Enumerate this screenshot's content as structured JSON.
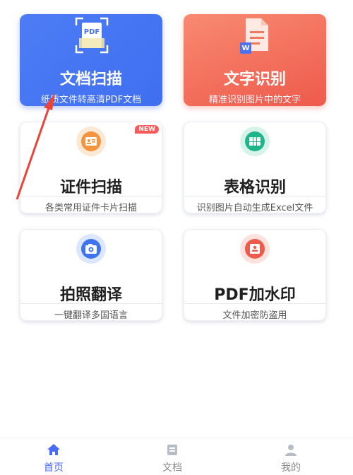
{
  "cards": {
    "doc_scan": {
      "title": "文档扫描",
      "subtitle": "纸质文件转高清PDF文档",
      "icon_label": "PDF"
    },
    "text_recognition": {
      "title": "文字识别",
      "subtitle": "精准识别图片中的文字",
      "icon_label": "W"
    },
    "id_scan": {
      "title": "证件扫描",
      "subtitle": "各类常用证件卡片扫描",
      "badge": "NEW"
    },
    "table_recognition": {
      "title": "表格识别",
      "subtitle": "识别图片自动生成Excel文件"
    },
    "photo_translate": {
      "title": "拍照翻译",
      "subtitle": "一键翻译多国语言"
    },
    "pdf_watermark": {
      "title": "PDF加水印",
      "subtitle": "文件加密防盗用"
    }
  },
  "nav": {
    "home": "首页",
    "docs": "文档",
    "mine": "我的"
  },
  "colors": {
    "blue_card": "#4876f3",
    "red_card": "#f26e5a",
    "active_nav": "#4a6cf0",
    "arrow": "#e8443a"
  },
  "icons": {
    "doc_scan": "pdf-scan-icon",
    "text_recognition": "word-document-icon",
    "id_scan": "id-card-icon",
    "table_recognition": "table-icon",
    "photo_translate": "camera-translate-icon",
    "pdf_watermark": "stamp-icon",
    "nav_home": "home-icon",
    "nav_docs": "documents-icon",
    "nav_mine": "user-icon"
  }
}
